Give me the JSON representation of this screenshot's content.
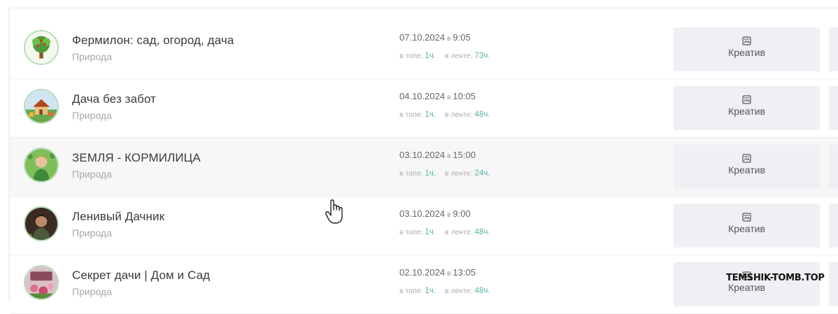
{
  "channels": [
    {
      "title": "Фермилон: сад, огород, дача",
      "category": "Природа",
      "date": "07.10.2024",
      "sep": "в",
      "time": "9:05",
      "top_label": "в топе:",
      "top_value": "1ч.",
      "feed_label": "в ленте:",
      "feed_value": "73ч.",
      "button_label": "Креатив",
      "avatar": "tree-avatar"
    },
    {
      "title": "Дача без забот",
      "category": "Природа",
      "date": "04.10.2024",
      "sep": "в",
      "time": "10:05",
      "top_label": "в топе:",
      "top_value": "1ч.",
      "feed_label": "в ленте:",
      "feed_value": "48ч.",
      "button_label": "Креатив",
      "avatar": "house-avatar"
    },
    {
      "title": "ЗЕМЛЯ - КОРМИЛИЦА",
      "category": "Природа",
      "date": "03.10.2024",
      "sep": "в",
      "time": "15:00",
      "top_label": "в топе:",
      "top_value": "1ч.",
      "feed_label": "в ленте:",
      "feed_value": "24ч.",
      "button_label": "Креатив",
      "avatar": "woman-garden-avatar"
    },
    {
      "title": "Ленивый Дачник",
      "category": "Природа",
      "date": "03.10.2024",
      "sep": "в",
      "time": "9:00",
      "top_label": "в топе:",
      "top_value": "1ч.",
      "feed_label": "в ленте:",
      "feed_value": "48ч.",
      "button_label": "Креатив",
      "avatar": "man-avatar"
    },
    {
      "title": "Секрет дачи | Дом и Сад",
      "category": "Природа",
      "date": "02.10.2024",
      "sep": "в",
      "time": "13:05",
      "top_label": "в топе:",
      "top_value": "1ч.",
      "feed_label": "в ленте:",
      "feed_value": "48ч.",
      "button_label": "Креатив",
      "avatar": "flowers-avatar"
    }
  ],
  "watermark": "TEMSHIK-TOMB.TOP",
  "colors": {
    "accent": "#4fb3a9",
    "avatar_border": "#b8dcb8",
    "button_bg": "#eef0f4",
    "hover_row": "#f7f7f7"
  },
  "icons": {
    "button": "image-icon",
    "cursor": "hand-pointer-icon"
  }
}
